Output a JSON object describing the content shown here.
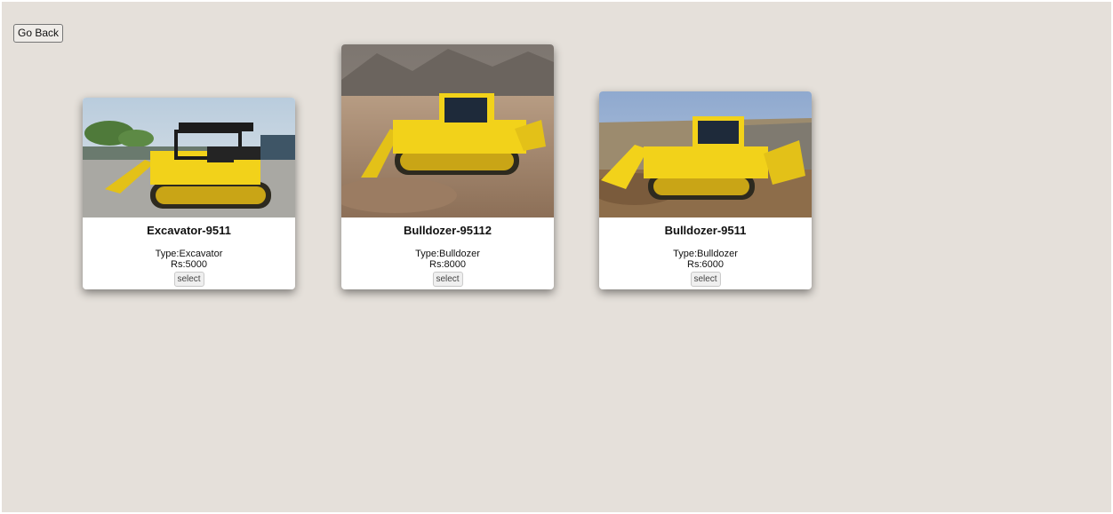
{
  "nav": {
    "go_back_label": "Go Back"
  },
  "cards": [
    {
      "title": "Excavator-9511",
      "type_line": "Type:Excavator",
      "price_line": "Rs:5000",
      "select_label": "select",
      "image": "yellow-bulldozer-parking-lot-photo"
    },
    {
      "title": "Bulldozer-95112",
      "type_line": "Type:Bulldozer",
      "price_line": "Rs:8000",
      "select_label": "select",
      "image": "yellow-bulldozer-mountain-dirt-photo"
    },
    {
      "title": "Bulldozer-9511",
      "type_line": "Type:Bulldozer",
      "price_line": "Rs:6000",
      "select_label": "select",
      "image": "yellow-bulldozer-quarry-photo"
    }
  ],
  "colors": {
    "page_background": "#e5e0da",
    "machine_yellow": "#f2d21a"
  }
}
